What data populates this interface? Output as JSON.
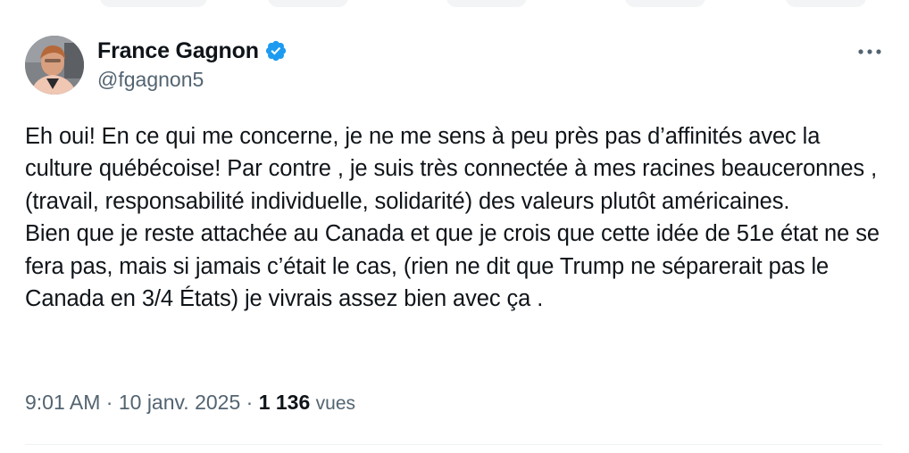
{
  "author": {
    "display_name": "France Gagnon",
    "handle": "@fgagnon5",
    "verified": true,
    "verified_color": "#1d9bf0"
  },
  "tweet": {
    "paragraphs": [
      "Eh oui! En ce qui me concerne, je ne me sens à peu près pas d’affinités avec la culture québécoise! Par contre , je suis très connectée à mes racines beauceronnes , (travail, responsabilité individuelle, solidarité) des valeurs plutôt américaines.",
      "Bien que je reste attachée au Canada et que je crois que cette idée de 51e état ne se fera pas, mais si jamais c’était le cas, (rien ne dit que Trump ne séparerait pas le Canada en 3/4 États) je vivrais assez bien avec ça ."
    ]
  },
  "meta": {
    "time": "9:01 AM",
    "separator": " · ",
    "date": "10 janv. 2025",
    "views_count": "1 136",
    "views_label": "vues"
  },
  "icons": {
    "more": "more-horizontal-icon",
    "verified": "verified-badge-icon"
  }
}
